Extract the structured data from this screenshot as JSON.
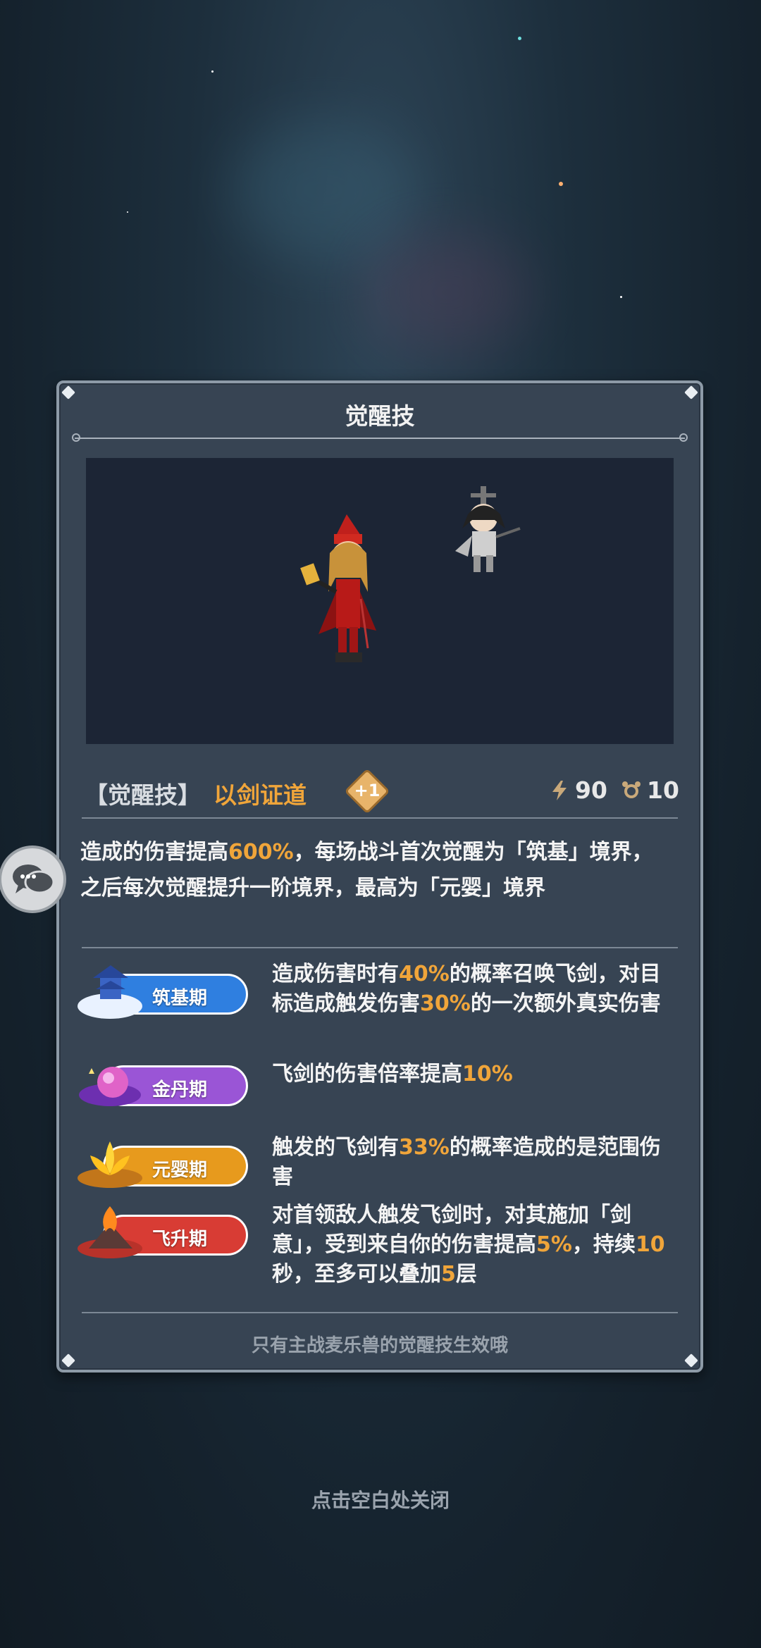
{
  "panel": {
    "title": "觉醒技",
    "skill_bracket": "【觉醒技】",
    "skill_name": "以剑证道",
    "plus_label": "+1",
    "energy": "90",
    "cooldown": "10",
    "energy_icon": "lightning-icon",
    "cooldown_icon": "alarm-clock-icon",
    "description": {
      "p1": "造成的伤害提高",
      "v1": "600%",
      "p2": "，每场战斗首次觉醒为「筑基」境界，之后每次觉醒提升一阶境界，最高为「元婴」境界"
    },
    "realms": [
      {
        "label": "筑基期",
        "emblem": "pagoda-cloud-icon",
        "color": "#2f7fe0",
        "t1": "造成伤害时有",
        "v1": "40%",
        "t2": "的概率召唤飞剑，对目标造成触发伤害",
        "v2": "30%",
        "t3": "的一次额外真实伤害"
      },
      {
        "label": "金丹期",
        "emblem": "golden-orb-icon",
        "color": "#9a55d6",
        "t1": "飞剑的伤害倍率提高",
        "v1": "10%"
      },
      {
        "label": "元婴期",
        "emblem": "lotus-icon",
        "color": "#e79a1d",
        "t1": "触发的飞剑有",
        "v1": "33%",
        "t2": "的概率造成的是范围伤害"
      },
      {
        "label": "飞升期",
        "emblem": "flame-mountain-icon",
        "color": "#d83c34",
        "t1": "对首领敌人触发飞剑时，对其施加「剑意」，受到来自你的伤害提高",
        "v1": "5%",
        "t2": "，持续",
        "v2": "10",
        "t3": "秒，至多可以叠加",
        "v3": "5",
        "t4": "层"
      }
    ],
    "footer_note": "只有主战麦乐兽的觉醒技生效哦"
  },
  "close_hint": "点击空白处关闭",
  "accent_color": "#f0a53a"
}
